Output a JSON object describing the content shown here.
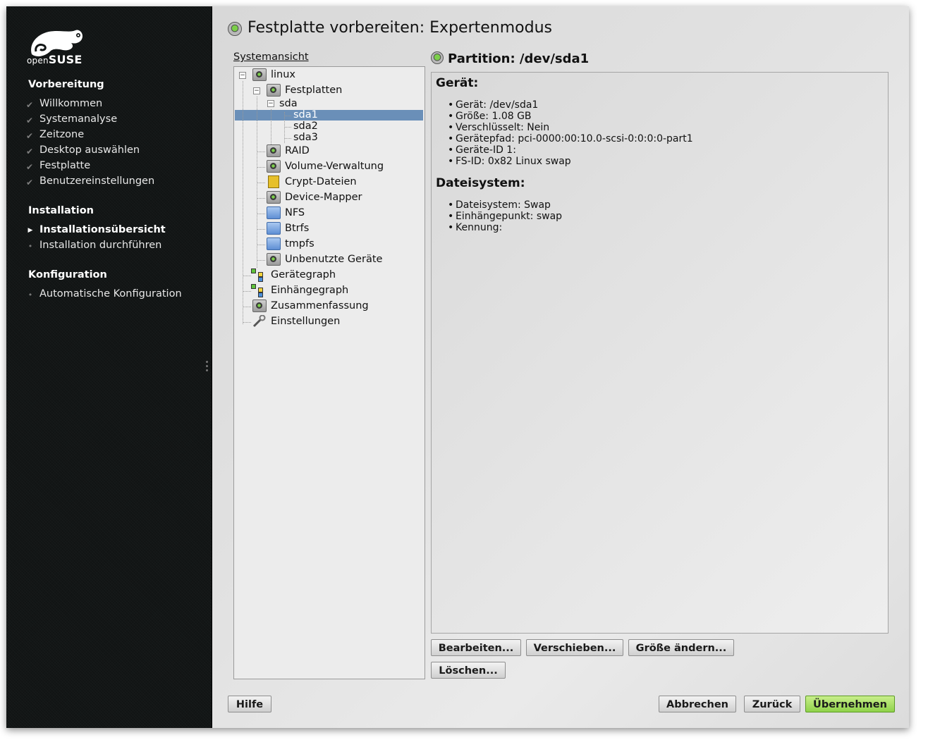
{
  "sidebar": {
    "logo": {
      "text_open": "open",
      "text_suse": "SUSE"
    },
    "sections": [
      {
        "title": "Vorbereitung",
        "items": [
          {
            "label": "Willkommen",
            "state": "done"
          },
          {
            "label": "Systemanalyse",
            "state": "done"
          },
          {
            "label": "Zeitzone",
            "state": "done"
          },
          {
            "label": "Desktop auswählen",
            "state": "done"
          },
          {
            "label": "Festplatte",
            "state": "done"
          },
          {
            "label": "Benutzereinstellungen",
            "state": "done"
          }
        ]
      },
      {
        "title": "Installation",
        "items": [
          {
            "label": "Installationsübersicht",
            "state": "current"
          },
          {
            "label": "Installation durchführen",
            "state": "todo"
          }
        ]
      },
      {
        "title": "Konfiguration",
        "items": [
          {
            "label": "Automatische Konfiguration",
            "state": "todo"
          }
        ]
      }
    ]
  },
  "main": {
    "title": "Festplatte vorbereiten: Expertenmodus",
    "tree_label": "Systemansicht",
    "tree": {
      "root": "linux",
      "festplatten": "Festplatten",
      "disk": "sda",
      "partitions": [
        "sda1",
        "sda2",
        "sda3"
      ],
      "selected": "sda1",
      "raid": "RAID",
      "volume": "Volume-Verwaltung",
      "crypt": "Crypt-Dateien",
      "devmapper": "Device-Mapper",
      "nfs": "NFS",
      "btrfs": "Btrfs",
      "tmpfs": "tmpfs",
      "unused": "Unbenutzte Geräte",
      "devgraph": "Gerätegraph",
      "mountgraph": "Einhängegraph",
      "summary": "Zusammenfassung",
      "settings": "Einstellungen"
    },
    "detail": {
      "header": "Partition: /dev/sda1",
      "device_heading": "Gerät:",
      "device_items": [
        "Gerät: /dev/sda1",
        "Größe: 1.08 GB",
        "Verschlüsselt: Nein",
        "Gerätepfad: pci-0000:00:10.0-scsi-0:0:0:0-part1",
        "Geräte-ID 1:",
        "FS-ID: 0x82 Linux swap"
      ],
      "fs_heading": "Dateisystem:",
      "fs_items": [
        "Dateisystem: Swap",
        "Einhängepunkt: swap",
        "Kennung:"
      ]
    },
    "buttons": {
      "edit": "Bearbeiten...",
      "move": "Verschieben...",
      "resize": "Größe ändern...",
      "delete": "Löschen...",
      "help": "Hilfe",
      "cancel": "Abbrechen",
      "back": "Zurück",
      "accept": "Übernehmen"
    }
  },
  "colors": {
    "sidebar_bg": "#111414",
    "selection": "#6a8fb8",
    "accept_button": "#a6de66"
  }
}
